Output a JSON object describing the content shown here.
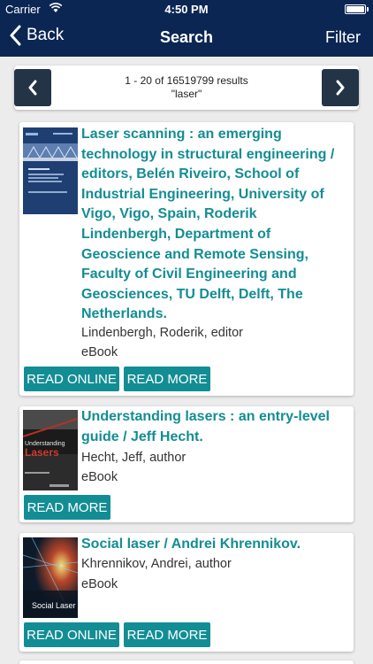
{
  "status": {
    "carrier": "Carrier",
    "time": "4:50 PM"
  },
  "nav": {
    "back_label": "Back",
    "title": "Search",
    "filter_label": "Filter"
  },
  "pager": {
    "range_text": "1 - 20 of 16519799 results",
    "query_text": "\"laser\""
  },
  "results": [
    {
      "title": "Laser scanning : an emerging technology in structural engineering / editors, Belén Riveiro, School of Industrial Engineering, University of Vigo, Vigo, Spain, Roderik Lindenbergh, Department of Geoscience and Remote Sensing, Faculty of Civil Engineering and Geosciences, TU Delft, Delft, The Netherlands.",
      "author": "Lindenbergh, Roderik, editor",
      "format": "eBook",
      "read_online": "READ ONLINE",
      "read_more": "READ MORE"
    },
    {
      "title": "Understanding lasers : an entry-level guide / Jeff Hecht.",
      "author": "Hecht, Jeff, author",
      "format": "eBook",
      "read_more": "READ MORE",
      "cover_text": "Understanding Lasers"
    },
    {
      "title": "Social laser / Andrei Khrennikov.",
      "author": "Khrennikov, Andrei, author",
      "format": "eBook",
      "read_online": "READ ONLINE",
      "read_more": "READ MORE",
      "cover_text": "Social Laser"
    }
  ],
  "colors": {
    "navbar": "#0b2653",
    "accent": "#138d94",
    "pager_button": "#243447",
    "background": "#ececec"
  }
}
